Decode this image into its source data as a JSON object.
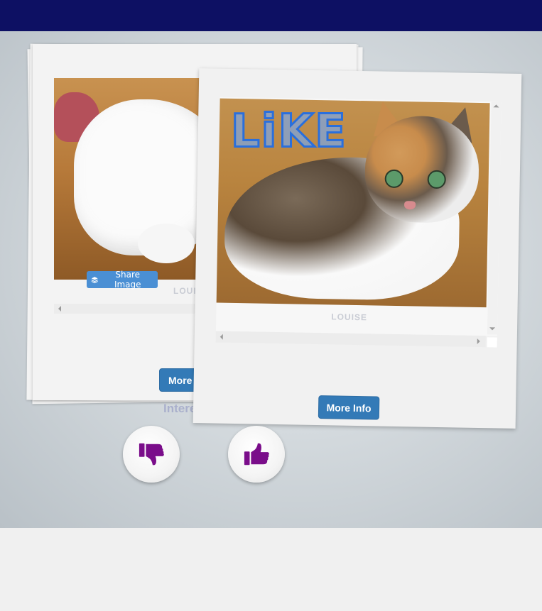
{
  "header": {
    "bg_color": "#0d1063"
  },
  "back_card": {
    "share_label": "Share Image",
    "share_icon": "layers-icon",
    "name": "LOUISE",
    "more_label": "More Info"
  },
  "front_card": {
    "stamp": "LiKE",
    "name": "LOUISE",
    "more_label": "More Info"
  },
  "interested_label": "Interested?",
  "votes": {
    "dislike_icon": "thumbs-down-icon",
    "like_icon": "thumbs-up-icon",
    "icon_color": "#7a0d8a"
  },
  "colors": {
    "button_blue": "#337ab7",
    "share_blue": "#4a8fd4"
  }
}
